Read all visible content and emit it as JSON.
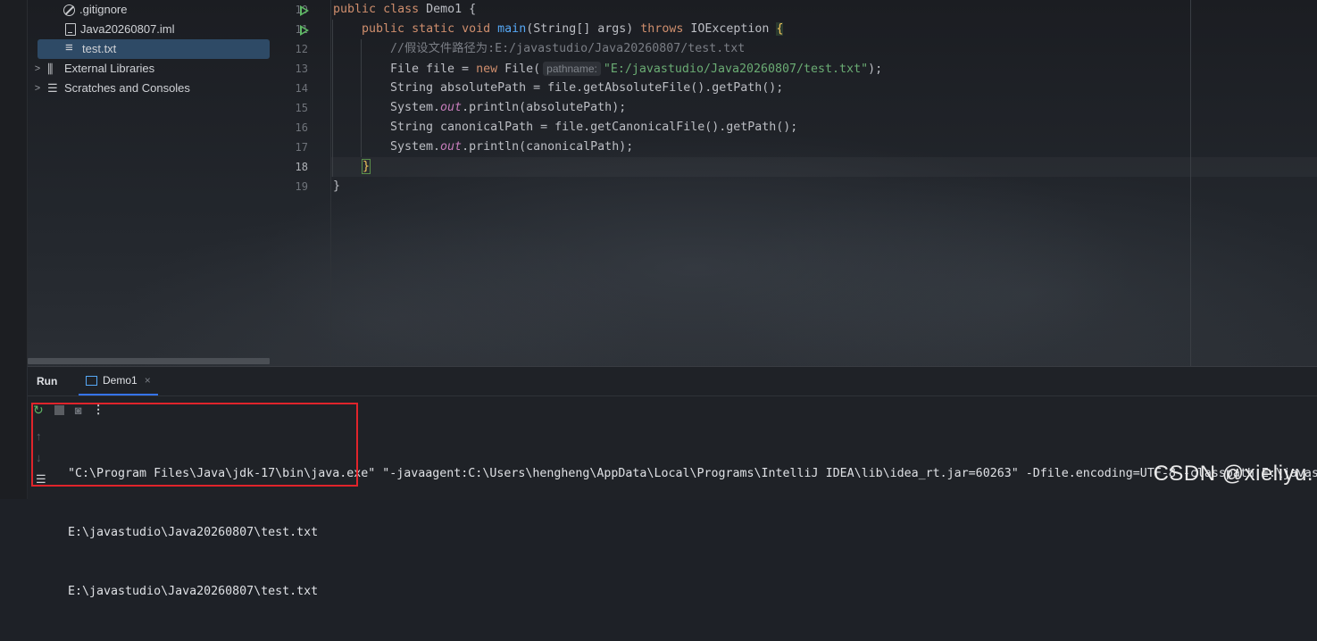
{
  "project_tree": {
    "items": [
      {
        "label": ".gitignore",
        "icon": "ignore-file-icon"
      },
      {
        "label": "Java20260807.iml",
        "icon": "iml-file-icon"
      },
      {
        "label": "test.txt",
        "icon": "text-file-icon",
        "selected": true
      },
      {
        "label": "External Libraries",
        "icon": "library-icon",
        "expandable": true
      },
      {
        "label": "Scratches and Consoles",
        "icon": "scratches-icon",
        "expandable": true
      }
    ]
  },
  "editor": {
    "line_numbers": [
      "10",
      "11",
      "12",
      "13",
      "14",
      "15",
      "16",
      "17",
      "18",
      "19"
    ],
    "lines": {
      "l10": {
        "kw1": "public",
        "kw2": "class",
        "rest": " Demo1 {"
      },
      "l11": {
        "kw1": "public",
        "kw2": "static",
        "kw3": "void",
        "fn": "main",
        "mid": "(String[] args) ",
        "kw4": "throws",
        "rest": " IOException ",
        "brace": "{"
      },
      "l12": {
        "comment": "//假设文件路径为:E:/javastudio/Java20260807/test.txt"
      },
      "l13": {
        "pre": "File file = ",
        "kw": "new",
        "post": " File(",
        "hint": "pathname:",
        "str": "\"E:/javastudio/Java20260807/test.txt\"",
        "end": ");"
      },
      "l14": {
        "text": "String absolutePath = file.getAbsoluteFile().getPath();"
      },
      "l15": {
        "pre": "System.",
        "field": "out",
        "post": ".println(absolutePath);"
      },
      "l16": {
        "text": "String canonicalPath = file.getCanonicalFile().getPath();"
      },
      "l17": {
        "pre": "System.",
        "field": "out",
        "post": ".println(canonicalPath);"
      },
      "l18": {
        "brace": "}"
      },
      "l19": {
        "text": "}"
      }
    }
  },
  "run_panel": {
    "title": "Run",
    "tab_label": "Demo1",
    "tab_close": "×",
    "toolbar_more": "⋮",
    "console_lines": [
      "\"C:\\Program Files\\Java\\jdk-17\\bin\\java.exe\" \"-javaagent:C:\\Users\\hengheng\\AppData\\Local\\Programs\\IntelliJ IDEA\\lib\\idea_rt.jar=60263\" -Dfile.encoding=UTF-8 -classpath E:\\javastudio",
      "E:\\javastudio\\Java20260807\\test.txt",
      "E:\\javastudio\\Java20260807\\test.txt"
    ]
  },
  "watermark": "CSDN @xieliyu.",
  "colors": {
    "keyword": "#cf8e6d",
    "function": "#56a8f5",
    "string": "#6aab73",
    "comment": "#7a7e85",
    "static_field": "#c77dbb",
    "run_icon": "#5fb865",
    "highlight_box": "#e0242b",
    "selection": "#2e4a66"
  }
}
